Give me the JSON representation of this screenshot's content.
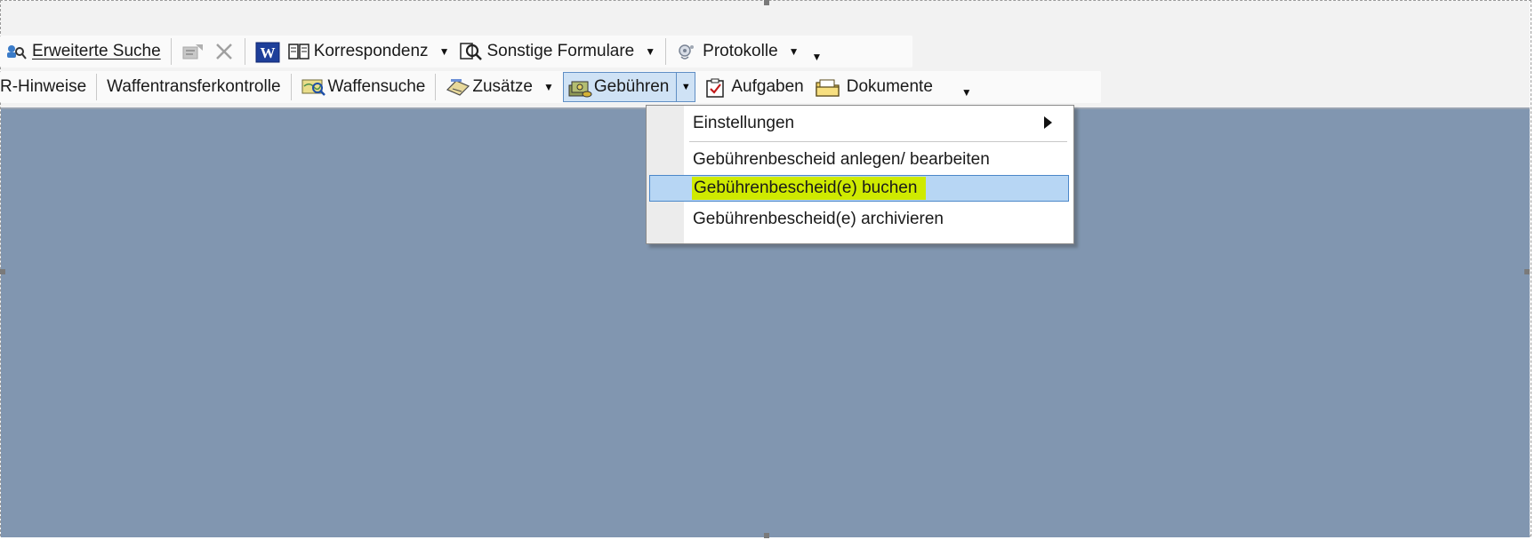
{
  "toolbar_row1": {
    "extended_search": "Erweiterte Suche",
    "correspondence": "Korrespondenz",
    "other_forms": "Sonstige Formulare",
    "protocols": "Protokolle"
  },
  "toolbar_row2": {
    "hints": "R-Hinweise",
    "weapon_transfer_control": "Waffentransferkontrolle",
    "weapon_search": "Waffensuche",
    "additions": "Zusätze",
    "fees": "Gebühren",
    "tasks": "Aufgaben",
    "documents": "Dokumente"
  },
  "fees_menu": {
    "items": [
      "Einstellungen",
      "Gebührenbescheid anlegen/ bearbeiten",
      "Gebührenbescheid(e) buchen",
      "Gebührenbescheid(e) archivieren"
    ],
    "highlighted_index": 2
  },
  "icons": [
    "search-people-icon",
    "edit-disabled-icon",
    "delete-icon",
    "word-icon",
    "correspondence-icon",
    "form-search-icon",
    "protocol-icon",
    "map-search-icon",
    "additions-icon",
    "money-icon",
    "tasks-icon",
    "folder-icon"
  ],
  "colors": {
    "workspace": "#8196b0",
    "menu_highlight": "#b7d6f4",
    "marker": "#cfea00"
  }
}
